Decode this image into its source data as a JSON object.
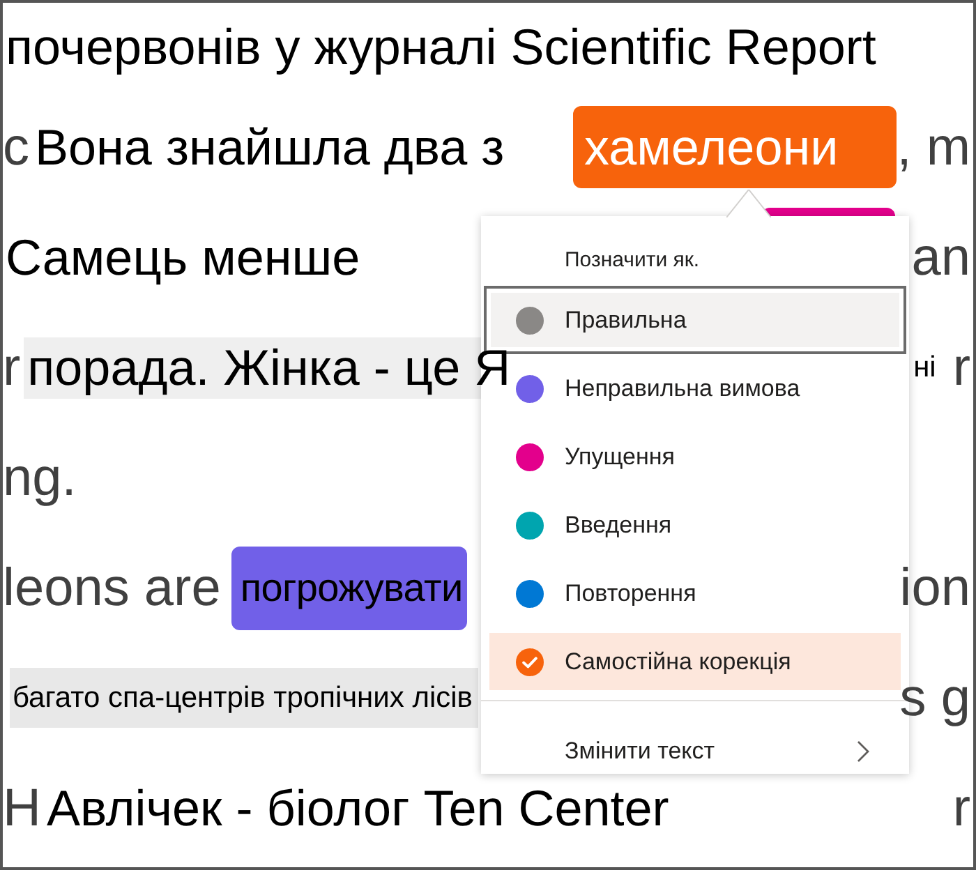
{
  "passage": {
    "lines": [
      {
        "segments": [
          {
            "kind": "overlay",
            "text": "почервонів у журналі Scientific Report",
            "shaded": false
          }
        ]
      },
      {
        "segments": [
          {
            "kind": "base",
            "text": "c"
          },
          {
            "kind": "overlay",
            "text": "Вона знайшла два з",
            "shaded": false
          },
          {
            "kind": "mark",
            "text": "хамелеони",
            "color": "#f7630c"
          },
          {
            "kind": "base",
            "text": ", m"
          }
        ]
      },
      {
        "segments": [
          {
            "kind": "overlay",
            "text": "Самець менше",
            "shaded": false
          },
          {
            "kind": "strip",
            "color": "#e3008c"
          },
          {
            "kind": "base",
            "text": "an"
          }
        ]
      },
      {
        "segments": [
          {
            "kind": "base",
            "text": "r"
          },
          {
            "kind": "overlay",
            "text": "порада. Жінка - це Я",
            "shaded": true
          },
          {
            "kind": "small",
            "text": "ні",
            "shaded": false
          },
          {
            "kind": "base",
            "text": "r"
          }
        ]
      },
      {
        "segments": [
          {
            "kind": "base",
            "text": "ng."
          }
        ]
      },
      {
        "segments": [
          {
            "kind": "base",
            "text": "leons are"
          },
          {
            "kind": "overlay",
            "text": "погрожувати",
            "color": "#7160e8"
          },
          {
            "kind": "base",
            "text": "ion"
          }
        ]
      },
      {
        "segments": [
          {
            "kind": "small",
            "text": "багато спа-центрів тропічних лісів",
            "shaded": true
          },
          {
            "kind": "base",
            "text": "s g"
          }
        ]
      },
      {
        "segments": [
          {
            "kind": "base",
            "text": "H"
          },
          {
            "kind": "overlay",
            "text": "Авлічек - біолог Ten Center",
            "shaded": false
          },
          {
            "kind": "base",
            "text": "r"
          }
        ]
      }
    ]
  },
  "menu": {
    "title": "Позначити як.",
    "items": [
      {
        "label": "Правильна",
        "color": "#8a8886",
        "selected": false,
        "focused": true
      },
      {
        "label": "Неправильна вимова",
        "color": "#7160e8",
        "selected": false,
        "focused": false
      },
      {
        "label": "Упущення",
        "color": "#e3008c",
        "selected": false,
        "focused": false
      },
      {
        "label": "Введення",
        "color": "#00a5af",
        "selected": false,
        "focused": false
      },
      {
        "label": "Повторення",
        "color": "#0078d4",
        "selected": false,
        "focused": false
      },
      {
        "label": "Самостійна корекція",
        "color": "#f7630c",
        "selected": true,
        "focused": false
      }
    ],
    "submenu_item": {
      "label": "Змінити текст"
    }
  }
}
